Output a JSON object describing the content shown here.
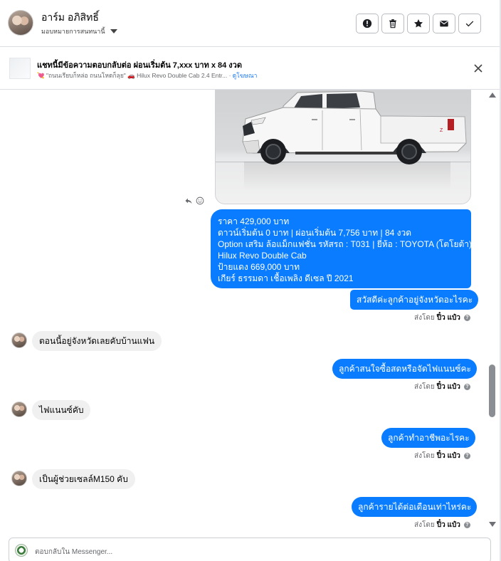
{
  "header": {
    "contact_name": "อาร์ม อภิสิทธิ์",
    "assign_label": "มอบหมายการสนทนานี้",
    "actions": [
      "mark-spam",
      "delete",
      "star",
      "mark-unread",
      "mark-done"
    ]
  },
  "ad": {
    "title": "แชทนี้มีข้อความตอบกลับต่อ ผ่อนเริ่มต้น 7,xxx บาท x 84 งวด",
    "desc_prefix": "💘 \"ถนนเรียบก็หล่อ ถนนโหดก็ลุย\" 🚗 Hilux Revo Double Cab 2.4 Entr... · ",
    "link": "ดูโฆษณา"
  },
  "messages": {
    "long_out": {
      "lines": [
        "ราคา 429,000 บาท",
        "ดาวน์เริ่มต้น 0 บาท | ผ่อนเริ่มต้น 7,756 บาท | 84 งวด",
        " Option เสริม ล้อแม็กแฟชั่น  รหัสรถ : T031 |  ยี่ห้อ : TOYOTA (โตโยต้า)",
        "Hilux Revo Double Cab",
        " ป้ายแดง 669,000 บาท",
        " เกียร์ ธรรมดา  เชื้อเพลิง ดีเซล  ปี 2021"
      ]
    },
    "out_1": "สวัสดีค่ะลูกค้าอยู่จังหวัดอะไรคะ",
    "in_1": "ตอนนี้อยู่จังหวัดเลยคับบ้านแฟน",
    "out_2": "ลูกค้าสนใจซื้อสดหรือจัดไฟแนนซ์คะ",
    "in_2": "ไฟแนนซ์คับ",
    "out_3": "ลูกค้าทำอาชีพอะไรคะ",
    "in_3": "เป็นผู้ช่วยเซลล์M150 คับ",
    "out_4": "ลูกค้ารายได้ต่อเดือนเท่าไหร่คะ",
    "sent_by_prefix": "ส่งโดย",
    "sender": "ปิ๋ว แป๋ว",
    "help_mark": "?"
  },
  "composer": {
    "placeholder": "ตอบกลับใน Messenger..."
  },
  "colors": {
    "outgoing_bubble": "#0a7cff",
    "incoming_bubble": "#f0f0f0",
    "link": "#1877f2"
  }
}
